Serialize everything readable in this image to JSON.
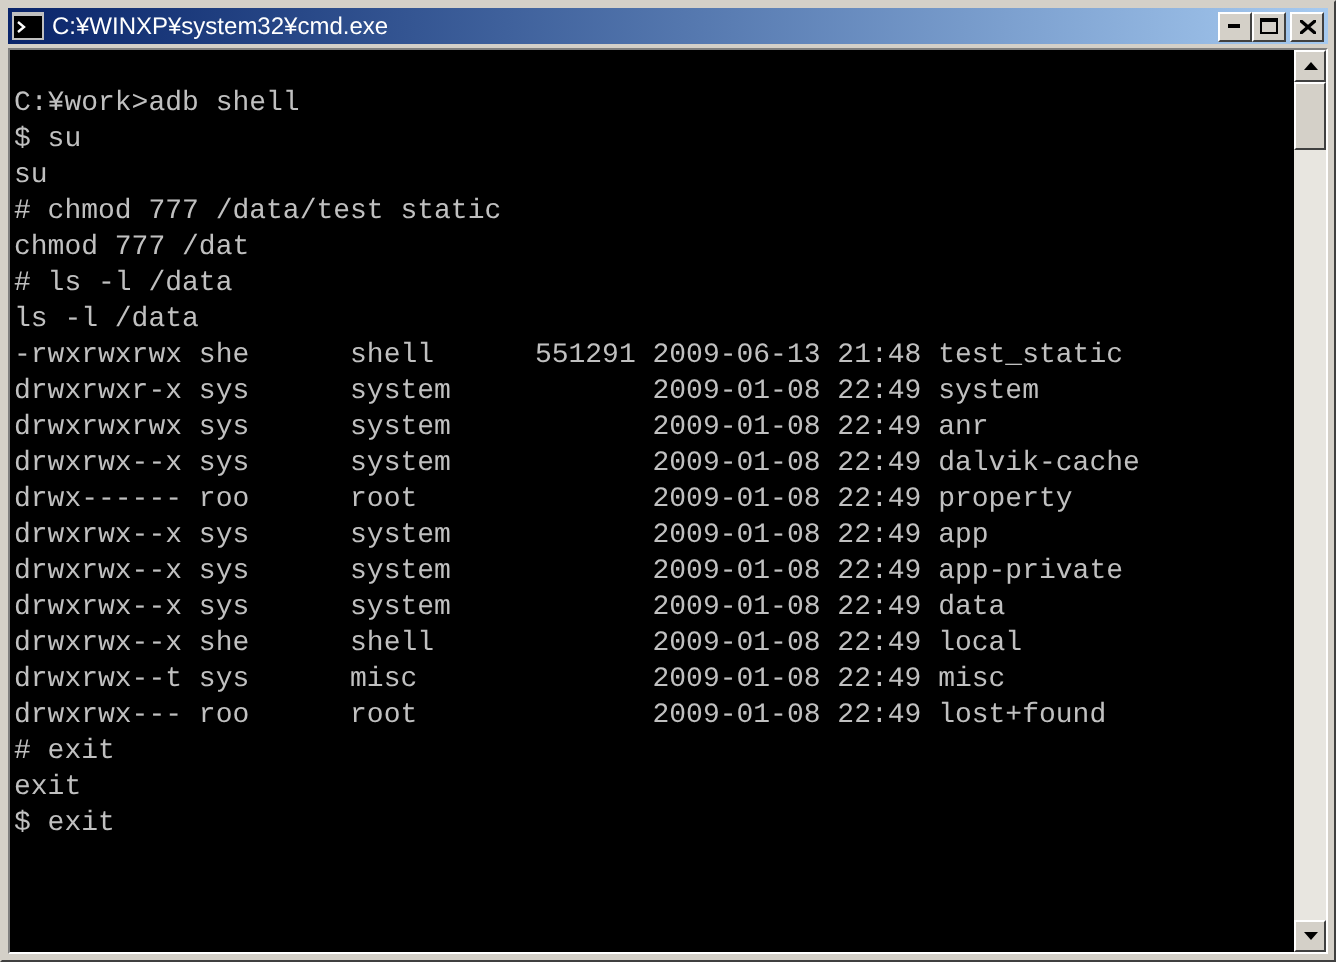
{
  "window": {
    "title": "C:¥WINXP¥system32¥cmd.exe"
  },
  "console": {
    "lines": [
      "C:¥work>adb shell",
      "$ su",
      "su",
      "# chmod 777 /data/test static",
      "chmod 777 /dat",
      "# ls -l /data",
      "ls -l /data",
      "-rwxrwxrwx she      shell      551291 2009-06-13 21:48 test_static",
      "drwxrwxr-x sys      system            2009-01-08 22:49 system",
      "drwxrwxrwx sys      system            2009-01-08 22:49 anr",
      "drwxrwx--x sys      system            2009-01-08 22:49 dalvik-cache",
      "drwx------ roo      root              2009-01-08 22:49 property",
      "drwxrwx--x sys      system            2009-01-08 22:49 app",
      "drwxrwx--x sys      system            2009-01-08 22:49 app-private",
      "drwxrwx--x sys      system            2009-01-08 22:49 data",
      "drwxrwx--x she      shell             2009-01-08 22:49 local",
      "drwxrwx--t sys      misc              2009-01-08 22:49 misc",
      "drwxrwx--- roo      root              2009-01-08 22:49 lost+found",
      "# exit",
      "exit",
      "$ exit"
    ]
  }
}
